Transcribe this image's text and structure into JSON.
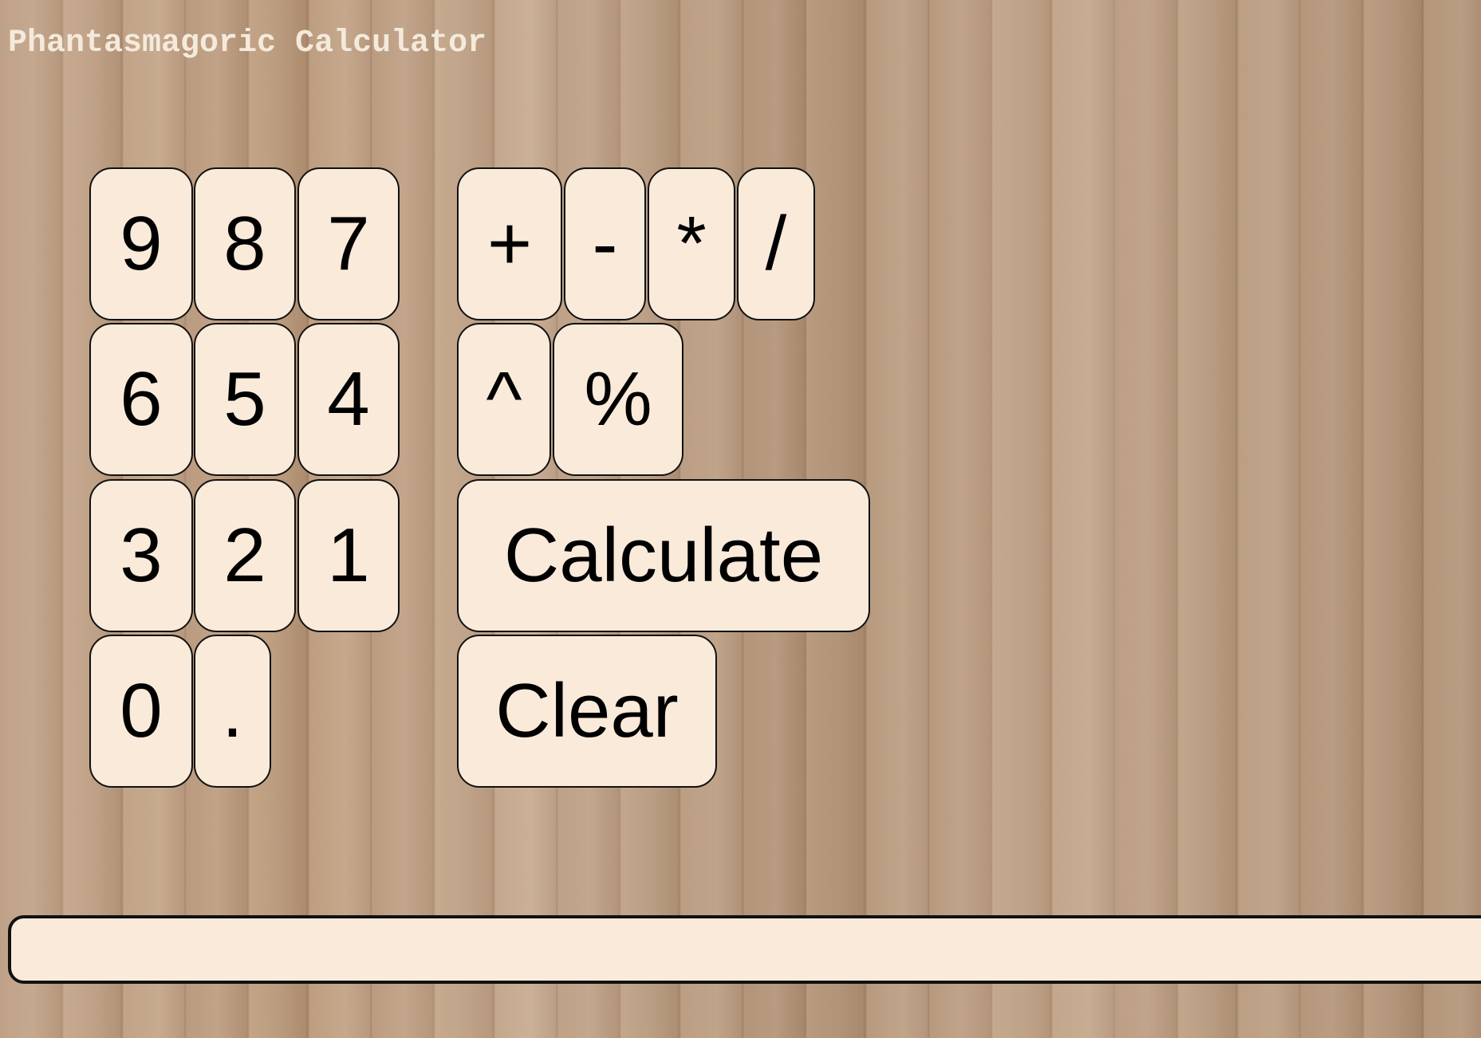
{
  "app": {
    "title": "Phantasmagoric Calculator"
  },
  "keys": {
    "nine": "9",
    "eight": "8",
    "seven": "7",
    "six": "6",
    "five": "5",
    "four": "4",
    "three": "3",
    "two": "2",
    "one": "1",
    "zero": "0",
    "dot": ".",
    "plus": "+",
    "minus": "-",
    "multiply": "*",
    "divide": "/",
    "power": "^",
    "percent": "%",
    "calculate": "Calculate",
    "clear": "Clear"
  },
  "display": {
    "value": ""
  }
}
